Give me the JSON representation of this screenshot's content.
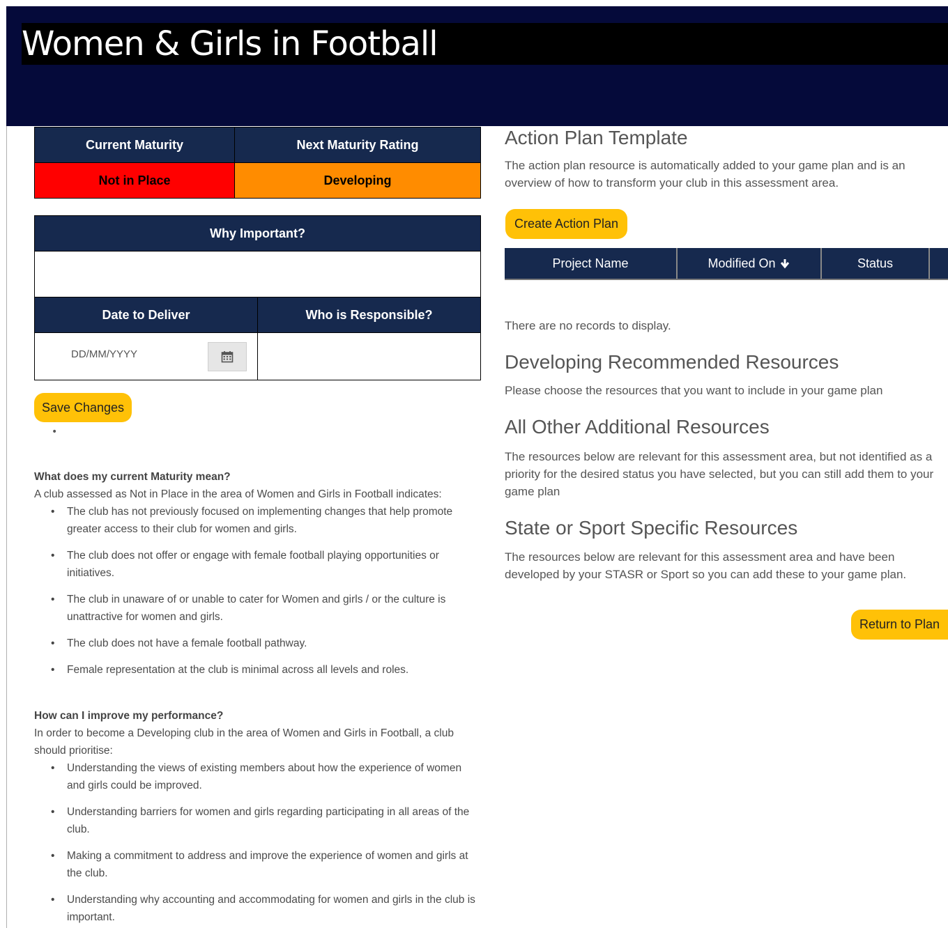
{
  "banner": {
    "title": "Women & Girls in Football"
  },
  "maturity": {
    "current_header": "Current Maturity",
    "next_header": "Next Maturity Rating",
    "current_value": "Not in Place",
    "next_value": "Developing",
    "colors": {
      "header": "#16294e",
      "not_in_place": "#ff0000",
      "developing": "#ff8c00"
    }
  },
  "form": {
    "why_header": "Why Important?",
    "date_header": "Date to Deliver",
    "who_header": "Who is Responsible?",
    "date_placeholder": "DD/MM/YYYY",
    "save_label": "Save Changes"
  },
  "current_meaning": {
    "heading": "What does my current Maturity mean?",
    "intro": "A club assessed as Not in Place in the area of Women and Girls in Football indicates:",
    "items": [
      "The club has not previously focused on implementing changes that help promote greater access to their club for women and girls.",
      "The club does not offer or engage with female football playing opportunities or initiatives.",
      "The club in unaware of or unable to cater for Women and girls / or the culture is unattractive for women and girls.",
      "The club does not have a female football pathway.",
      "Female representation at the club is minimal across all levels and roles."
    ]
  },
  "improve": {
    "heading": "How can I improve my performance?",
    "intro": "In order to become a Developing club in the area of Women and Girls in Football, a club should prioritise:",
    "items": [
      "Understanding the views of existing members about how the experience of women and girls could be improved.",
      "Understanding barriers for women and girls regarding participating in all areas of the club.",
      "Making a commitment to address and improve the experience of women and girls at the club.",
      "Understanding why accounting and accommodating for women and girls in the club is important."
    ]
  },
  "action_plan": {
    "heading": "Action Plan Template",
    "description": "The action plan resource is automatically added to your game plan and is an overview of how to transform your club in this assessment area.",
    "create_label": "Create Action Plan",
    "columns": [
      "Project Name",
      "Modified On",
      "Status"
    ],
    "empty_text": "There are no records to display."
  },
  "developing_resources": {
    "heading": "Developing Recommended Resources",
    "text": "Please choose the resources that you want to include in your game plan"
  },
  "other_resources": {
    "heading": "All Other Additional Resources",
    "text": "The resources below are relevant for this assessment area, but not identified as a priority for the desired status you have selected, but you can still add them to your game plan"
  },
  "state_resources": {
    "heading": "State or Sport Specific Resources",
    "text": "The resources below are relevant for this assessment area and have been developed by your STASR or Sport so you can add these to your game plan."
  },
  "return_label": "Return to Plan",
  "icons": {
    "calendar": "calendar-icon",
    "sort": "arrow-down-icon"
  }
}
